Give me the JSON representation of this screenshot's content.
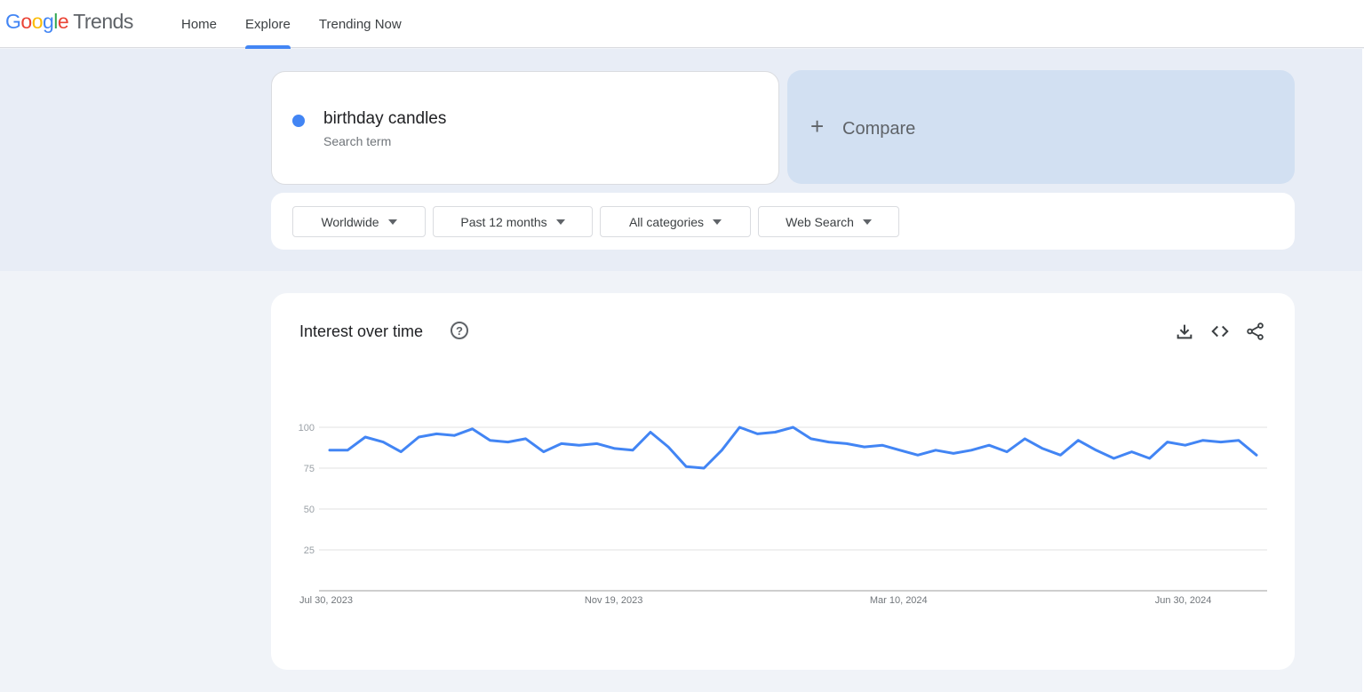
{
  "header": {
    "logo_letters": [
      "G",
      "o",
      "o",
      "g",
      "l",
      "e"
    ],
    "logo_product": "Trends",
    "nav": [
      {
        "label": "Home",
        "active": false
      },
      {
        "label": "Explore",
        "active": true
      },
      {
        "label": "Trending Now",
        "active": false
      }
    ]
  },
  "search": {
    "term": "birthday candles",
    "term_type": "Search term",
    "term_color": "#4285f4",
    "compare_label": "Compare",
    "compare_icon": "plus-icon"
  },
  "filters": [
    {
      "label": "Worldwide"
    },
    {
      "label": "Past 12 months"
    },
    {
      "label": "All categories"
    },
    {
      "label": "Web Search"
    }
  ],
  "card": {
    "title": "Interest over time",
    "help_icon": "?",
    "actions": [
      "download-icon",
      "embed-code-icon",
      "share-icon"
    ]
  },
  "chart_data": {
    "type": "line",
    "title": "Interest over time",
    "xlabel": "",
    "ylabel": "",
    "ylim": [
      0,
      100
    ],
    "yticks": [
      25,
      50,
      75,
      100
    ],
    "ytick_labels": [
      "25",
      "50",
      "75",
      "100"
    ],
    "grid": true,
    "x_tick_labels": [
      {
        "label": "Jul 30, 2023",
        "index": 0
      },
      {
        "label": "Nov 19, 2023",
        "index": 16
      },
      {
        "label": "Mar 10, 2024",
        "index": 32
      },
      {
        "label": "Jun 30, 2024",
        "index": 48
      }
    ],
    "series": [
      {
        "name": "birthday candles",
        "color": "#4285f4",
        "values": [
          86,
          86,
          94,
          91,
          85,
          94,
          96,
          95,
          99,
          92,
          91,
          93,
          85,
          90,
          89,
          90,
          87,
          86,
          97,
          88,
          76,
          75,
          86,
          100,
          96,
          97,
          100,
          93,
          91,
          90,
          88,
          89,
          86,
          83,
          86,
          84,
          86,
          89,
          85,
          93,
          87,
          83,
          92,
          86,
          81,
          85,
          81,
          91,
          89,
          92,
          91,
          92,
          83
        ]
      }
    ]
  }
}
